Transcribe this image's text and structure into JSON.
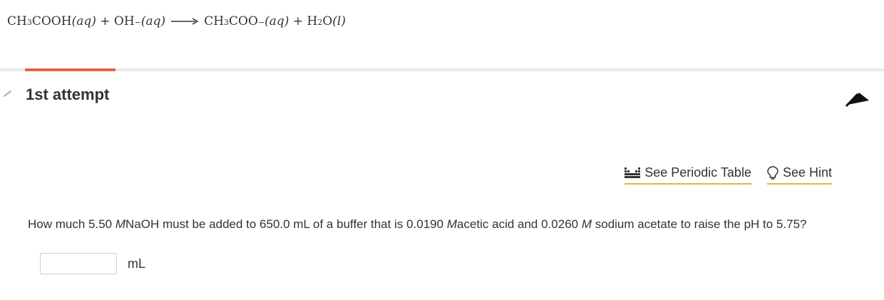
{
  "equation": {
    "reactant1": "CH",
    "reactant1_sub": "3",
    "reactant1_rest": "COOH",
    "reactant1_state": "(aq)",
    "plus1": "+",
    "reactant2": "OH",
    "reactant2_charge": "−",
    "reactant2_state": "(aq)",
    "product1": "CH",
    "product1_sub": "3",
    "product1_rest": "COO",
    "product1_charge": "−",
    "product1_state": "(aq)",
    "plus2": "+",
    "product2": "H",
    "product2_sub": "2",
    "product2_rest": "O",
    "product2_state": "(l)"
  },
  "attempt": {
    "label": "1st attempt"
  },
  "tools": {
    "periodic_table": "See Periodic Table",
    "hint": "See Hint"
  },
  "question": {
    "part1": "How much 5.50 ",
    "unit1": "M",
    "part2": "NaOH must be added to 650.0 mL of a buffer that is 0.0190 ",
    "unit2": "M",
    "part3": "acetic acid and 0.0260 ",
    "unit3": "M",
    "part4": " sodium acetate to raise the pH to 5.75?"
  },
  "answer": {
    "value": "",
    "unit": "mL"
  },
  "colors": {
    "accent": "#e85f45",
    "link_underline": "#e8b33b",
    "text": "#333333"
  }
}
